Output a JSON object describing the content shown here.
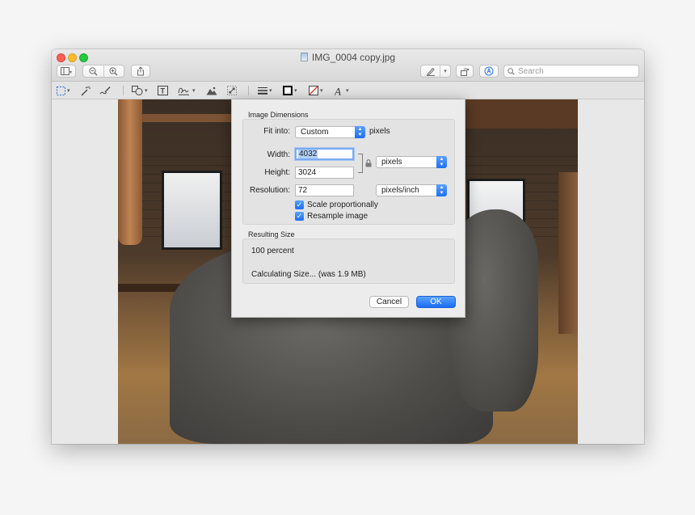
{
  "window": {
    "title": "IMG_0004 copy.jpg"
  },
  "toolbar": {
    "search_placeholder": "Search"
  },
  "icons": {
    "sidebar": "sidebar-toggle-icon",
    "zoom_out": "zoom-out-icon",
    "zoom_in": "zoom-in-icon",
    "share": "share-icon",
    "markup": "pen-icon",
    "rotate": "rotate-icon",
    "annotate": "markup-circle-icon",
    "search": "search-icon",
    "select": "rect-selection-icon",
    "instant_alpha": "magic-wand-icon",
    "sketch": "sketch-icon",
    "shapes": "shapes-icon",
    "text": "text-icon",
    "sign": "signature-icon",
    "adjust_color": "adjust-color-icon",
    "adjust_size": "resize-icon",
    "shape_style": "line-style-icon",
    "border_color": "border-color-icon",
    "fill_color": "fill-color-icon",
    "text_style": "text-style-icon",
    "lock": "lock-icon"
  },
  "colors": {
    "accent": "#1f6ff2",
    "close": "#fc5f57",
    "minimize": "#fdbc2e",
    "zoom": "#28c840"
  },
  "dialog": {
    "dimensions_title": "Image Dimensions",
    "fit_into_label": "Fit into:",
    "fit_into_value": "Custom",
    "fit_into_unit": "pixels",
    "width_label": "Width:",
    "width_value": "4032",
    "height_label": "Height:",
    "height_value": "3024",
    "size_unit": "pixels",
    "resolution_label": "Resolution:",
    "resolution_value": "72",
    "resolution_unit": "pixels/inch",
    "scale_label": "Scale proportionally",
    "resample_label": "Resample image",
    "resulting_title": "Resulting Size",
    "percent_text": "100 percent",
    "calc_text": "Calculating Size... (was 1.9 MB)",
    "cancel_label": "Cancel",
    "ok_label": "OK"
  }
}
